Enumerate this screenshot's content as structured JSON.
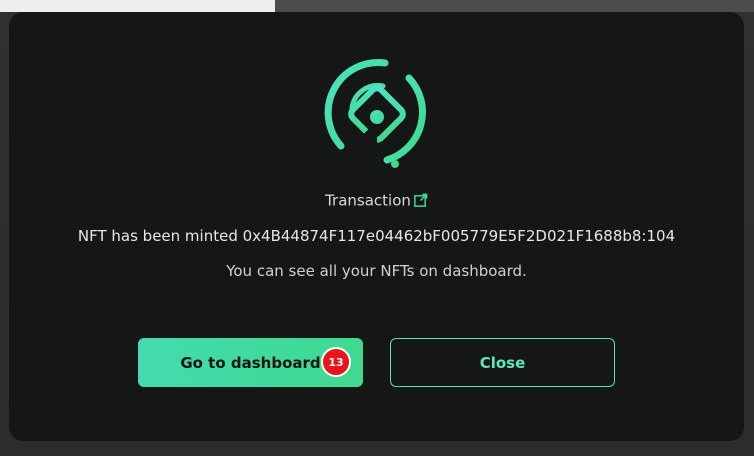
{
  "modal": {
    "transaction_label": "Transaction",
    "minted_message": "NFT has been minted 0x4B44874F117e04462bF005779E5F2D021F1688b8:104",
    "hint": "You can see all your NFTs on dashboard.",
    "primary_button": "Go to dashboard",
    "secondary_button": "Close",
    "badge_count": "13"
  },
  "icons": {
    "hero": "nft-minted-icon",
    "external_link": "external-link-icon"
  },
  "colors": {
    "accent": "#44dbb0",
    "accent_secondary": "#3fd98f",
    "modal_bg": "#151716",
    "badge": "#e8141c"
  }
}
